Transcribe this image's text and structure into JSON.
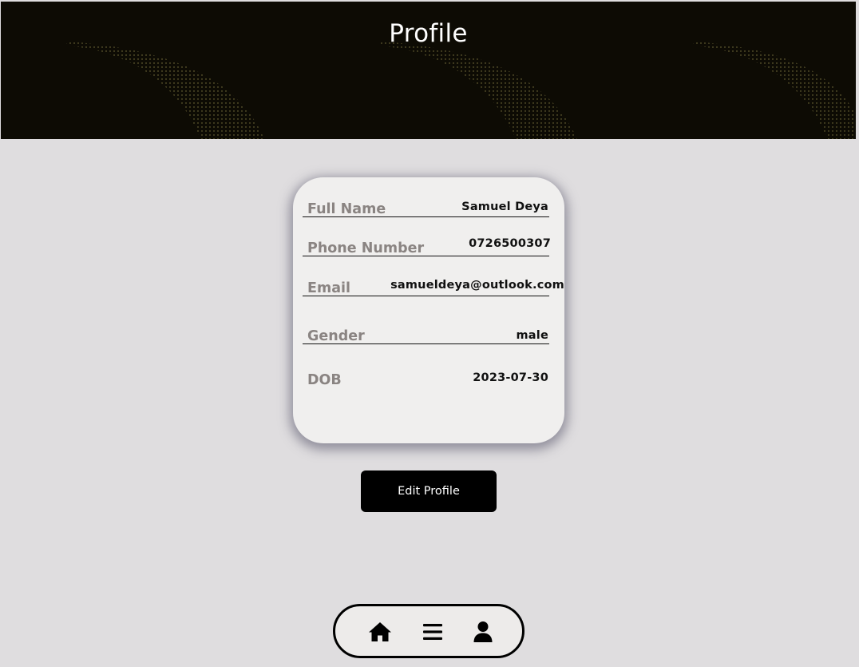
{
  "header": {
    "title": "Profile"
  },
  "profile": {
    "fields": [
      {
        "label": "Full Name",
        "value": "Samuel Deya"
      },
      {
        "label": "Phone Number",
        "value": "0726500307"
      },
      {
        "label": "Email",
        "value": "samueldeya@outlook.com"
      },
      {
        "label": "Gender",
        "value": "male"
      },
      {
        "label": "DOB",
        "value": "2023-07-30"
      }
    ]
  },
  "actions": {
    "edit_label": "Edit Profile"
  },
  "bottom_nav": {
    "items": [
      {
        "icon": "home-icon"
      },
      {
        "icon": "menu-icon"
      },
      {
        "icon": "user-icon"
      }
    ]
  },
  "colors": {
    "header_bg": "#0d0b04",
    "page_bg": "#dfdddf",
    "card_bg": "#f0efee",
    "label": "#8a8482",
    "button_bg": "#000000"
  }
}
